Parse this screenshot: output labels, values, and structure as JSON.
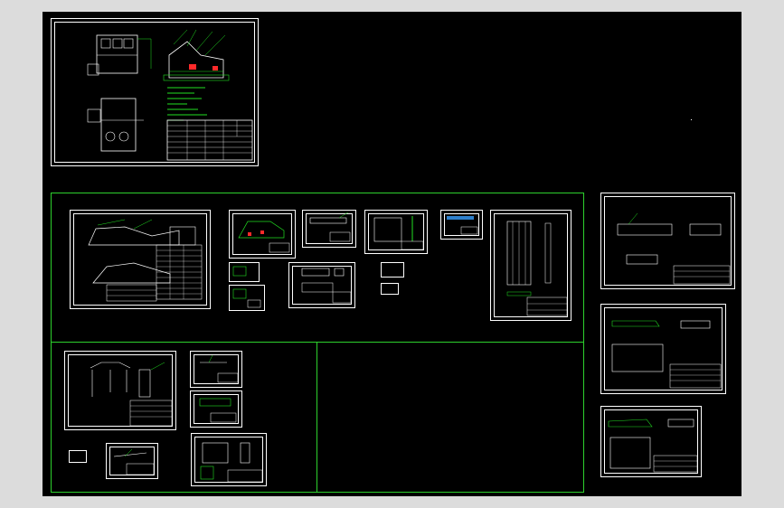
{
  "viewer": {
    "background_color": "#dcdcdc",
    "canvas_color": "#000000"
  },
  "colors": {
    "drawing_line": "#ffffff",
    "annotation": "#22e022",
    "highlight": "#ff2a2a",
    "accent_blue": "#3aa0ff"
  },
  "main_sheet": {
    "notes": [],
    "title_block_label": "",
    "drawing_number": ""
  },
  "groups": [
    {
      "name": "top-center-group"
    },
    {
      "name": "bottom-left-group"
    },
    {
      "name": "bottom-right-empty"
    }
  ]
}
